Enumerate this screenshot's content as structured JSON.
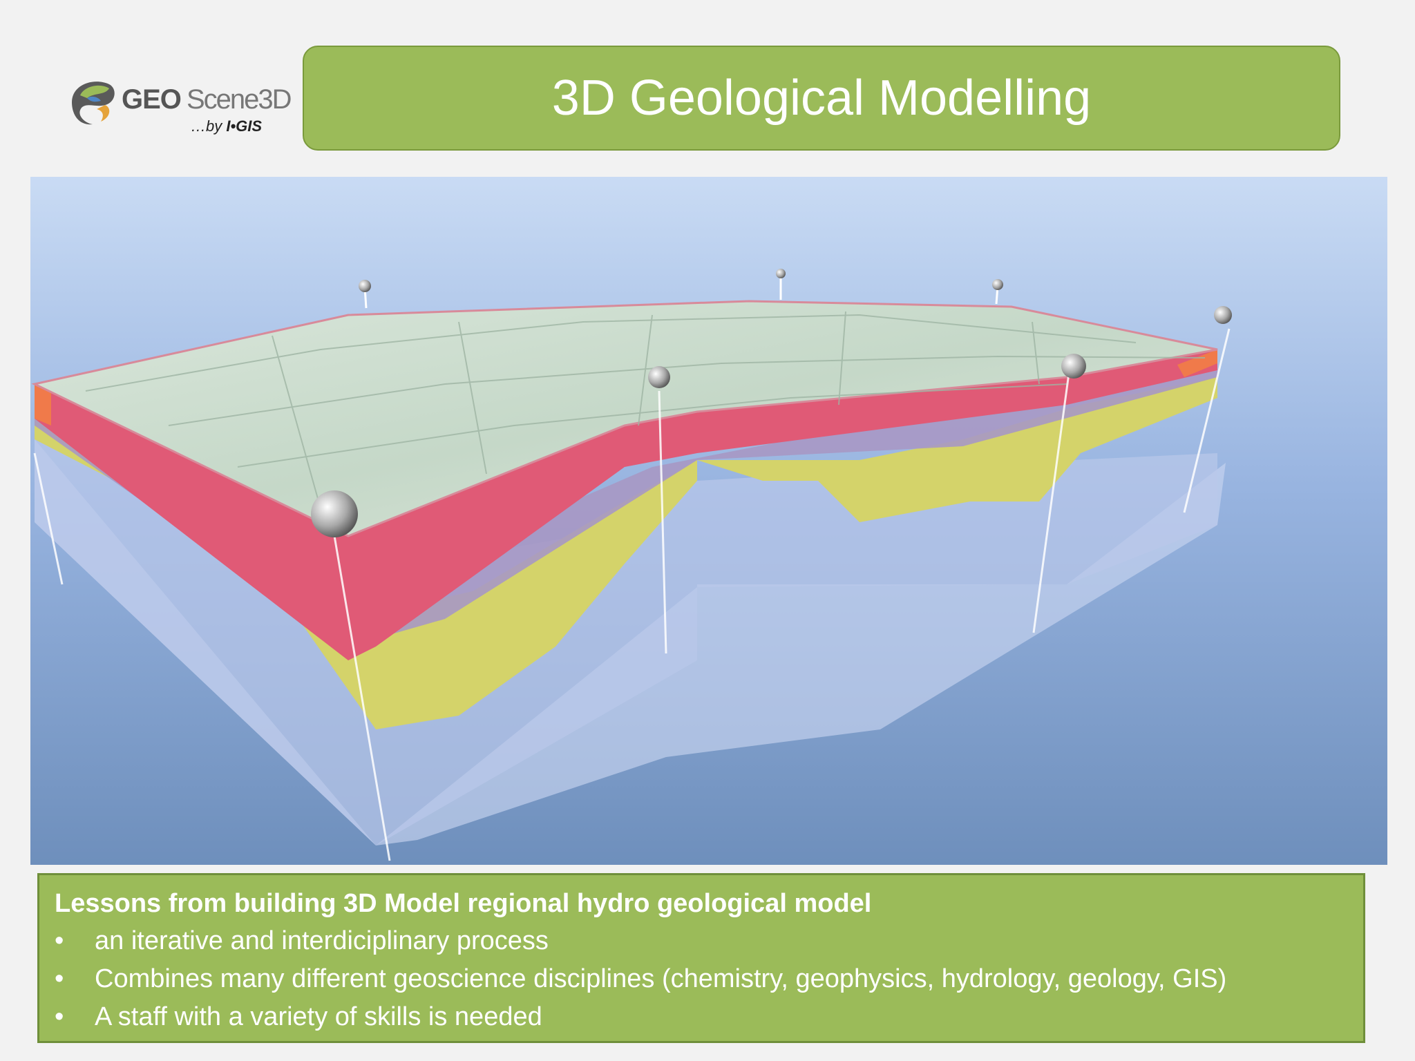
{
  "logo": {
    "brand_geo": "GEO",
    "brand_scene": "Scene3D",
    "byline_prefix": "…by ",
    "byline_org": "I•GIS"
  },
  "title": "3D Geological Modelling",
  "lessons": {
    "heading": "Lessons from building 3D Model regional hydro geological model",
    "bullet_glyph": "•",
    "items": [
      "an iterative and interdiciplinary process",
      "Combines many different geoscience disciplines (chemistry, geophysics, hydrology, geology, GIS)",
      "A staff with a variety of skills is needed"
    ]
  },
  "colors": {
    "accent_green": "#9bbb59",
    "layer_red": "#e05a76",
    "layer_yellow": "#d4d36a",
    "sky_blue": "#7d9cc9"
  }
}
